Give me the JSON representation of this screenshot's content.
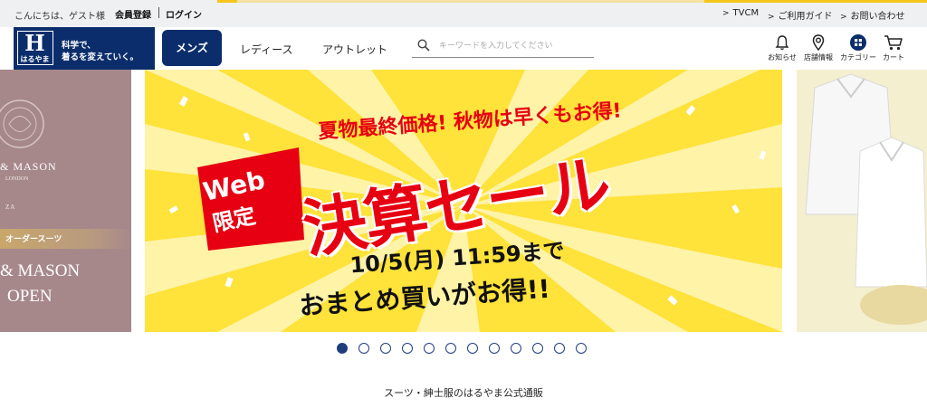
{
  "topbar": {
    "greeting": "こんにちは、ゲスト様",
    "register": "会員登録",
    "login": "ログイン",
    "links": [
      "TVCM",
      "ご利用ガイド",
      "お問い合わせ"
    ]
  },
  "header": {
    "logo_brand": "はるやま",
    "logo_tagline_1": "科学で、",
    "logo_tagline_2": "着るを変えていく。",
    "nav": [
      "メンズ",
      "レディース",
      "アウトレット"
    ],
    "search_placeholder": "キーワードを入力してください",
    "icons": [
      {
        "icon": "bell-icon",
        "label": "お知らせ"
      },
      {
        "icon": "pin-icon",
        "label": "店舗情報"
      },
      {
        "icon": "grid-icon",
        "label": "カテゴリー"
      },
      {
        "icon": "cart-icon",
        "label": "カート"
      }
    ]
  },
  "banner_left": {
    "brand_line": "& MASON",
    "sub_line": "LONDON",
    "city": "ZA",
    "band": "オーダースーツ",
    "title_1": "& MASON",
    "title_2": "OPEN"
  },
  "banner_main": {
    "headline": "夏物最終価格! 秋物は早くもお得!",
    "badge_1": "Web",
    "badge_2": "限定",
    "title": "決算セール",
    "date": "10/5(月) 11:59まで",
    "subline": "おまとめ買いがお得!!"
  },
  "carousel": {
    "dot_count": 12,
    "active_index": 0
  },
  "footer": {
    "tagline": "スーツ・紳士服のはるやま公式通販"
  },
  "colors": {
    "navy": "#0b2d6b",
    "sale_red": "#e60012",
    "sale_yellow": "#ffe23a"
  }
}
